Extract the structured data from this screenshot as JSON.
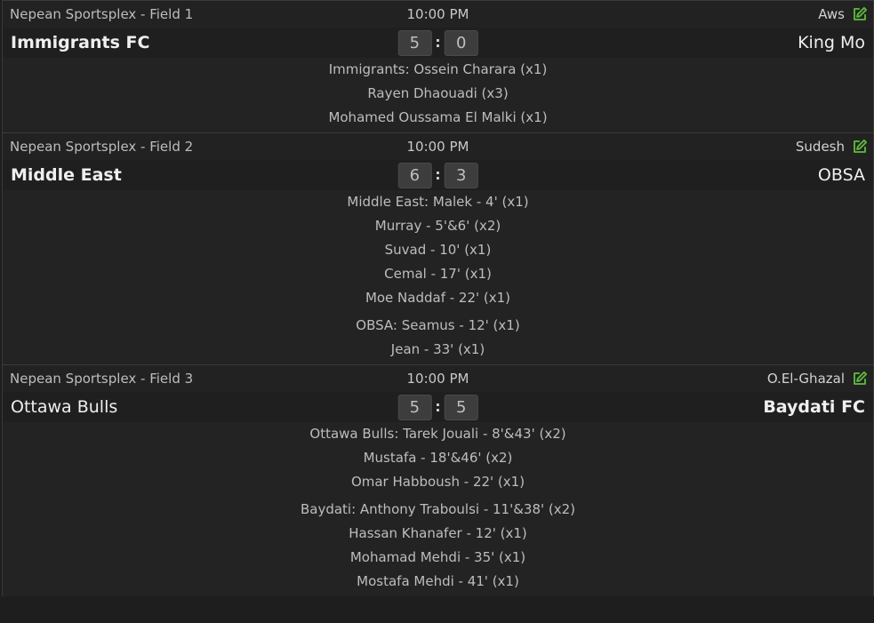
{
  "accent_color": "#5fbe3c",
  "matches": [
    {
      "venue": "Nepean Sportsplex - Field 1",
      "time": "10:00 PM",
      "reporter": "Aws",
      "home_team": "Immigrants FC",
      "away_team": "King Mo",
      "home_score": "5",
      "away_score": "0",
      "groups": [
        [
          "Immigrants: Ossein Charara (x1)",
          "Rayen Dhaouadi (x3)",
          "Mohamed Oussama El Malki (x1)"
        ]
      ]
    },
    {
      "venue": "Nepean Sportsplex - Field 2",
      "time": "10:00 PM",
      "reporter": "Sudesh",
      "home_team": "Middle East",
      "away_team": "OBSA",
      "home_score": "6",
      "away_score": "3",
      "groups": [
        [
          "Middle East: Malek - 4' (x1)",
          "Murray - 5'&6' (x2)",
          "Suvad - 10' (x1)",
          "Cemal - 17' (x1)",
          "Moe Naddaf - 22' (x1)"
        ],
        [
          "OBSA: Seamus - 12' (x1)",
          "Jean - 33' (x1)"
        ]
      ]
    },
    {
      "venue": "Nepean Sportsplex - Field 3",
      "time": "10:00 PM",
      "reporter": "O.El-Ghazal",
      "home_team": "Ottawa Bulls",
      "away_team": "Baydati FC",
      "home_score": "5",
      "away_score": "5",
      "groups": [
        [
          "Ottawa Bulls: Tarek Jouali - 8'&43' (x2)",
          "Mustafa - 18'&46' (x2)",
          "Omar Habboush - 22' (x1)"
        ],
        [
          "Baydati: Anthony Traboulsi - 11'&38' (x2)",
          "Hassan Khanafer - 12' (x1)",
          "Mohamad Mehdi - 35' (x1)",
          "Mostafa Mehdi - 41' (x1)"
        ]
      ]
    }
  ]
}
